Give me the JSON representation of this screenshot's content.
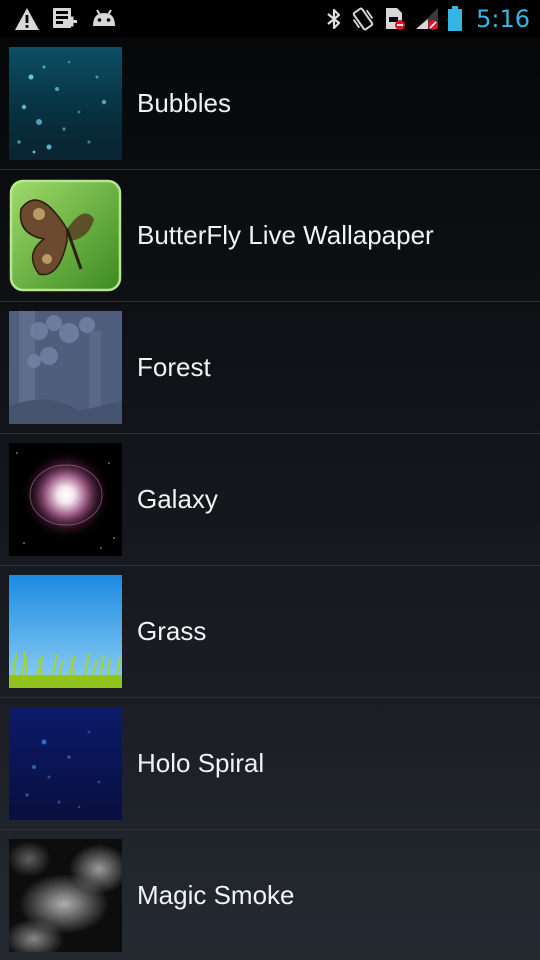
{
  "status_bar": {
    "time": "5:16",
    "time_color": "#33b5e5",
    "left_icons": [
      "warning-icon",
      "sd-card-icon",
      "android-debug-icon"
    ],
    "right_icons": [
      "bluetooth-icon",
      "vibrate-icon",
      "sim-card-icon",
      "signal-icon",
      "battery-icon"
    ]
  },
  "wallpapers": [
    {
      "label": "Bubbles",
      "icon": "bubbles-thumbnail"
    },
    {
      "label": "ButterFly Live Wallapaper",
      "icon": "butterfly-thumbnail"
    },
    {
      "label": "Forest",
      "icon": "forest-thumbnail"
    },
    {
      "label": "Galaxy",
      "icon": "galaxy-thumbnail"
    },
    {
      "label": "Grass",
      "icon": "grass-thumbnail"
    },
    {
      "label": "Holo Spiral",
      "icon": "holo-spiral-thumbnail"
    },
    {
      "label": "Magic Smoke",
      "icon": "magic-smoke-thumbnail"
    }
  ]
}
